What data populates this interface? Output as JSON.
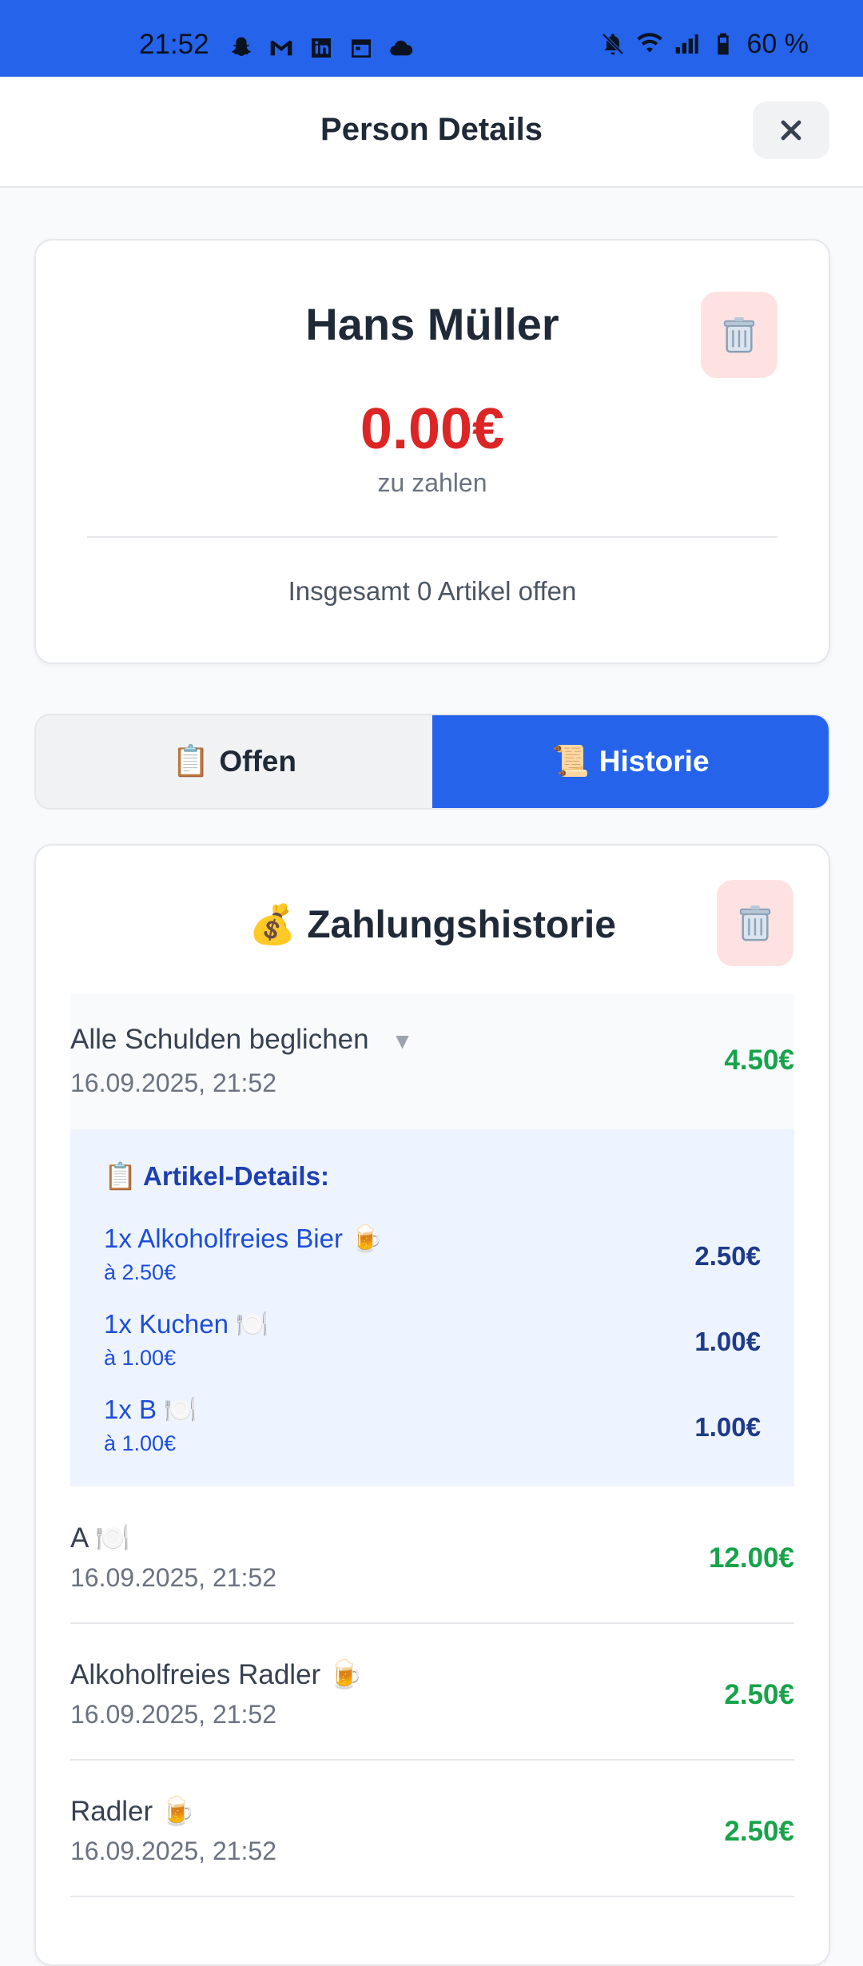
{
  "status_bar": {
    "time": "21:52",
    "left_icons": [
      "snapchat-icon",
      "gmail-icon",
      "linkedin-icon",
      "calendar-icon",
      "cloud-icon"
    ],
    "right_icons": [
      "bell-muted-icon",
      "wifi-icon",
      "signal-icon",
      "battery-icon"
    ],
    "battery": "60 %"
  },
  "header": {
    "title": "Person Details",
    "close_icon": "close-icon"
  },
  "person": {
    "name": "Hans Müller",
    "amount": "0.00€",
    "amount_label": "zu zahlen",
    "summary": "Insgesamt 0 Artikel offen",
    "delete_icon": "trash-icon"
  },
  "tabs": [
    {
      "emoji": "📋",
      "label": "Offen",
      "active": false
    },
    {
      "emoji": "📜",
      "label": "Historie",
      "active": true
    }
  ],
  "history": {
    "emoji": "💰",
    "title": "Zahlungshistorie",
    "delete_icon": "trash-icon",
    "expanded": {
      "title": "Alle Schulden beglichen",
      "caret": "▼",
      "date": "16.09.2025, 21:52",
      "amount": "4.50€",
      "details_heading": "📋 Artikel-Details:",
      "items": [
        {
          "name": "1x Alkoholfreies Bier 🍺",
          "unit": "à 2.50€",
          "price": "2.50€"
        },
        {
          "name": "1x Kuchen 🍽️",
          "unit": "à 1.00€",
          "price": "1.00€"
        },
        {
          "name": "1x B 🍽️",
          "unit": "à 1.00€",
          "price": "1.00€"
        }
      ]
    },
    "rows": [
      {
        "title": "A 🍽️",
        "date": "16.09.2025, 21:52",
        "amount": "12.00€"
      },
      {
        "title": "Alkoholfreies Radler 🍺",
        "date": "16.09.2025, 21:52",
        "amount": "2.50€"
      },
      {
        "title": "Radler 🍺",
        "date": "16.09.2025, 21:52",
        "amount": "2.50€"
      }
    ]
  },
  "colors": {
    "accent": "#2563eb",
    "amount_due": "#dc2626",
    "paid": "#16a34a",
    "delete_bg": "#fee2e2",
    "details_bg": "#eef4ff"
  }
}
